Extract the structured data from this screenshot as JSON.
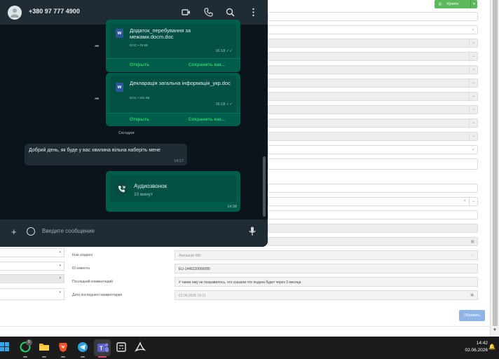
{
  "crm": {
    "call_button_label": "Купити",
    "fields": [
      {
        "label": "Кем создано",
        "value": "Aleksandr 685"
      },
      {
        "label": "ID клиента",
        "value": "EU-1446220666085"
      },
      {
        "label": "Последний комментарий",
        "value": "# также ему не понравилось, что сказали что подача будет через 3 месяца"
      },
      {
        "label": "Дата последнего комментария",
        "value": "01.06.2026 16:11"
      }
    ],
    "update_button_label": "Обновить"
  },
  "whatsapp": {
    "contact_phone": "+380 97 777 4900",
    "docs": [
      {
        "name": "Додаток_перебування за межами.docm.doc",
        "meta": "DOC • 45 КБ",
        "time": "16:18",
        "open_label": "Открыть",
        "save_label": "Сохранить как..."
      },
      {
        "name": "Декларація загальна інформація_укр.doc",
        "meta": "DOC • 201 КБ",
        "time": "16:18",
        "open_label": "Открыть",
        "save_label": "Сохранить как..."
      }
    ],
    "date_separator": "Сегодня",
    "incoming_message": {
      "text": "Добрий день, як буде у вас хвилина вільна наберіть мене",
      "time": "14:17"
    },
    "call": {
      "title": "Аудиозвонок",
      "duration": "10 минут",
      "time": "14:38"
    },
    "composer_placeholder": "Введите сообщение"
  },
  "taskbar": {
    "time": "14:42",
    "date": "02.06.2026",
    "whatsapp_badge": "5",
    "icons": [
      "windows-start-icon",
      "whatsapp-icon",
      "file-explorer-icon",
      "brave-icon",
      "telegram-icon",
      "teams-icon",
      "calculator-icon",
      "acrobat-icon"
    ]
  }
}
